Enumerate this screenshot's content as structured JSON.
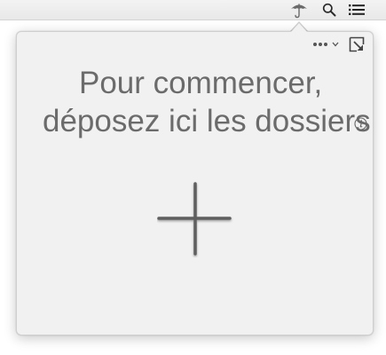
{
  "menubar": {
    "icons": [
      "umbrella-icon",
      "search-icon",
      "list-icon"
    ]
  },
  "popover": {
    "headline_line1": "Pour commencer,",
    "headline_line2": "déposez ici les dossiers",
    "toolbar": {
      "more_icon": "ellipsis-icon",
      "detach_icon": "detach-window-icon"
    },
    "info_icon": "info-icon",
    "add_icon": "plus-icon"
  },
  "colors": {
    "popover_bg": "#f1f1f1",
    "text": "#6b6b6b",
    "icon": "#555555"
  }
}
